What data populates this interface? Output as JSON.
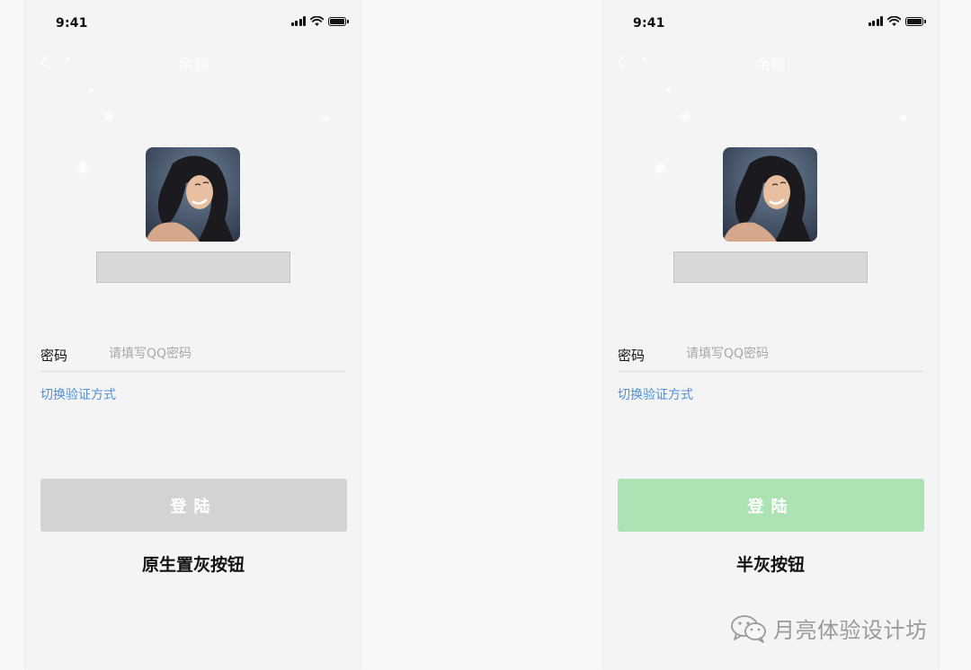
{
  "status_bar": {
    "time": "9:41"
  },
  "nav": {
    "title": "余额"
  },
  "login_form": {
    "password_label": "密码",
    "password_placeholder": "请填写QQ密码",
    "switch_verification": "切换验证方式",
    "login_button": "登陆"
  },
  "screens": [
    {
      "caption": "原生置灰按钮",
      "button_color": "#d3d3d3"
    },
    {
      "caption": "半灰按钮",
      "button_color": "#ade3b4"
    }
  ],
  "watermark": {
    "text": "月亮体验设计坊"
  },
  "colors": {
    "link": "#4f8fd8",
    "background": "#f8f8f8"
  }
}
